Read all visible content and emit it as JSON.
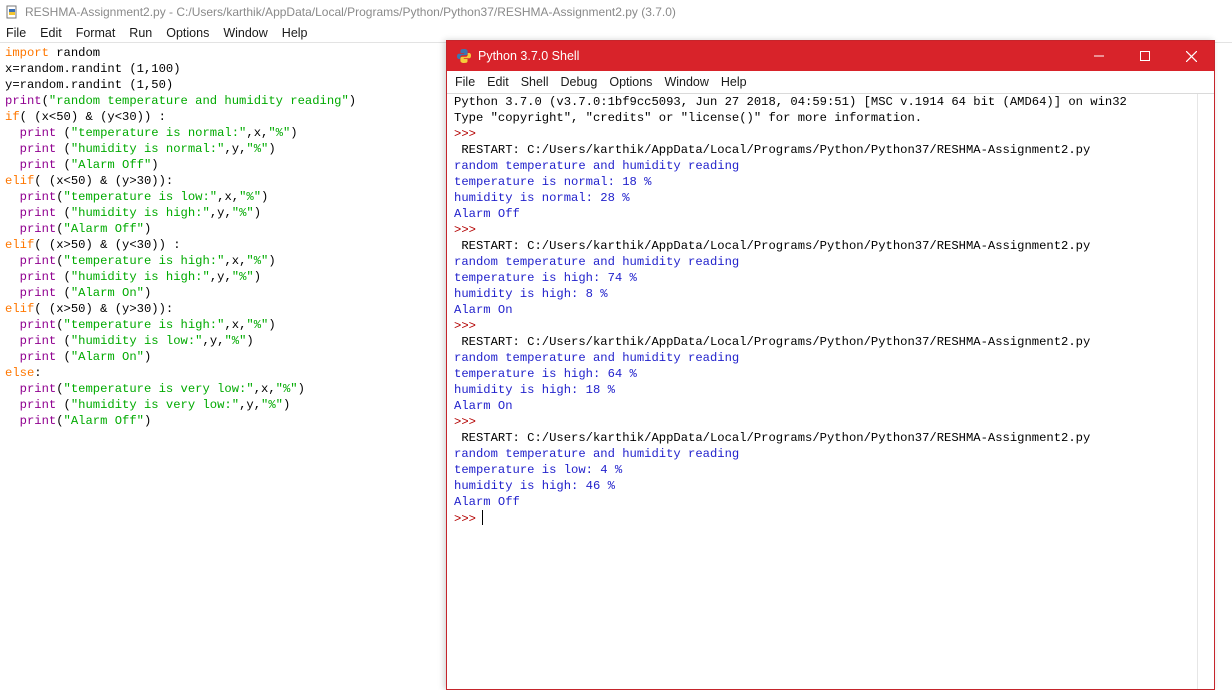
{
  "editor": {
    "title": "RESHMA-Assignment2.py - C:/Users/karthik/AppData/Local/Programs/Python/Python37/RESHMA-Assignment2.py (3.7.0)",
    "menu": [
      "File",
      "Edit",
      "Format",
      "Run",
      "Options",
      "Window",
      "Help"
    ],
    "code": [
      {
        "kw": "import",
        "rest": " random"
      },
      {
        "plain": "x=random.randint (1,100)"
      },
      {
        "plain": "y=random.randint (1,50)"
      },
      {
        "bi": "print",
        "plain": "(",
        "str": "\"random temperature and humidity reading\"",
        "end": ")"
      },
      {
        "kw": "if",
        "plain": "( (x<50) & (y<30)) :"
      },
      {
        "bi": "  print",
        "plain": " (",
        "str": "\"temperature is normal:\"",
        "mid": ",x,",
        "str2": "\"%\"",
        "end": ")"
      },
      {
        "bi": "  print",
        "plain": " (",
        "str": "\"humidity is normal:\"",
        "mid": ",y,",
        "str2": "\"%\"",
        "end": ")"
      },
      {
        "bi": "  print",
        "plain": " (",
        "str": "\"Alarm Off\"",
        "end": ")"
      },
      {
        "kw": "elif",
        "plain": "( (x<50) & (y>30)):"
      },
      {
        "bi": "  print",
        "plain": "(",
        "str": "\"temperature is low:\"",
        "mid": ",x,",
        "str2": "\"%\"",
        "end": ")"
      },
      {
        "bi": "  print",
        "plain": " (",
        "str": "\"humidity is high:\"",
        "mid": ",y,",
        "str2": "\"%\"",
        "end": ")"
      },
      {
        "bi": "  print",
        "plain": "(",
        "str": "\"Alarm Off\"",
        "end": ")"
      },
      {
        "kw": "elif",
        "plain": "( (x>50) & (y<30)) :"
      },
      {
        "bi": "  print",
        "plain": "(",
        "str": "\"temperature is high:\"",
        "mid": ",x,",
        "str2": "\"%\"",
        "end": ")"
      },
      {
        "bi": "  print",
        "plain": " (",
        "str": "\"humidity is high:\"",
        "mid": ",y,",
        "str2": "\"%\"",
        "end": ")"
      },
      {
        "bi": "  print",
        "plain": " (",
        "str": "\"Alarm On\"",
        "end": ")"
      },
      {
        "kw": "elif",
        "plain": "( (x>50) & (y>30)):"
      },
      {
        "bi": "  print",
        "plain": "(",
        "str": "\"temperature is high:\"",
        "mid": ",x,",
        "str2": "\"%\"",
        "end": ")"
      },
      {
        "bi": "  print",
        "plain": " (",
        "str": "\"humidity is low:\"",
        "mid": ",y,",
        "str2": "\"%\"",
        "end": ")"
      },
      {
        "bi": "  print",
        "plain": " (",
        "str": "\"Alarm On\"",
        "end": ")"
      },
      {
        "kw": "else",
        "plain": ":"
      },
      {
        "bi": "  print",
        "plain": "(",
        "str": "\"temperature is very low:\"",
        "mid": ",x,",
        "str2": "\"%\"",
        "end": ")"
      },
      {
        "bi": "  print",
        "plain": " (",
        "str": "\"humidity is very low:\"",
        "mid": ",y,",
        "str2": "\"%\"",
        "end": ")"
      },
      {
        "bi": "  print",
        "plain": "(",
        "str": "\"Alarm Off\"",
        "end": ")"
      }
    ]
  },
  "shell": {
    "title": "Python 3.7.0 Shell",
    "controls": {
      "minimize": "—",
      "maximize": "☐",
      "close": "✕"
    },
    "menu": [
      "File",
      "Edit",
      "Shell",
      "Debug",
      "Options",
      "Window",
      "Help"
    ],
    "lines": [
      {
        "t": "Python 3.7.0 (v3.7.0:1bf9cc5093, Jun 27 2018, 04:59:51) [MSC v.1914 64 bit (AMD64)] on win32",
        "c": "black"
      },
      {
        "t": "Type \"copyright\", \"credits\" or \"license()\" for more information.",
        "c": "black"
      },
      {
        "t": ">>>",
        "c": "prompt"
      },
      {
        "t": " RESTART: C:/Users/karthik/AppData/Local/Programs/Python/Python37/RESHMA-Assignment2.py",
        "c": "black"
      },
      {
        "t": "random temperature and humidity reading",
        "c": "out"
      },
      {
        "t": "temperature is normal: 18 %",
        "c": "out"
      },
      {
        "t": "humidity is normal: 28 %",
        "c": "out"
      },
      {
        "t": "Alarm Off",
        "c": "out"
      },
      {
        "t": ">>>",
        "c": "prompt"
      },
      {
        "t": " RESTART: C:/Users/karthik/AppData/Local/Programs/Python/Python37/RESHMA-Assignment2.py",
        "c": "black"
      },
      {
        "t": "random temperature and humidity reading",
        "c": "out"
      },
      {
        "t": "temperature is high: 74 %",
        "c": "out"
      },
      {
        "t": "humidity is high: 8 %",
        "c": "out"
      },
      {
        "t": "Alarm On",
        "c": "out"
      },
      {
        "t": ">>>",
        "c": "prompt"
      },
      {
        "t": " RESTART: C:/Users/karthik/AppData/Local/Programs/Python/Python37/RESHMA-Assignment2.py",
        "c": "black"
      },
      {
        "t": "random temperature and humidity reading",
        "c": "out"
      },
      {
        "t": "temperature is high: 64 %",
        "c": "out"
      },
      {
        "t": "humidity is high: 18 %",
        "c": "out"
      },
      {
        "t": "Alarm On",
        "c": "out"
      },
      {
        "t": ">>>",
        "c": "prompt"
      },
      {
        "t": " RESTART: C:/Users/karthik/AppData/Local/Programs/Python/Python37/RESHMA-Assignment2.py",
        "c": "black"
      },
      {
        "t": "random temperature and humidity reading",
        "c": "out"
      },
      {
        "t": "temperature is low: 4 %",
        "c": "out"
      },
      {
        "t": "humidity is high: 46 %",
        "c": "out"
      },
      {
        "t": "Alarm Off",
        "c": "out"
      }
    ],
    "final_prompt": ">>>"
  },
  "colors": {
    "shell_titlebar": "#d8232a",
    "keyword": "#ff7700",
    "builtin": "#900090",
    "string": "#00aa00",
    "output": "#2222cc",
    "prompt": "#b30000"
  }
}
